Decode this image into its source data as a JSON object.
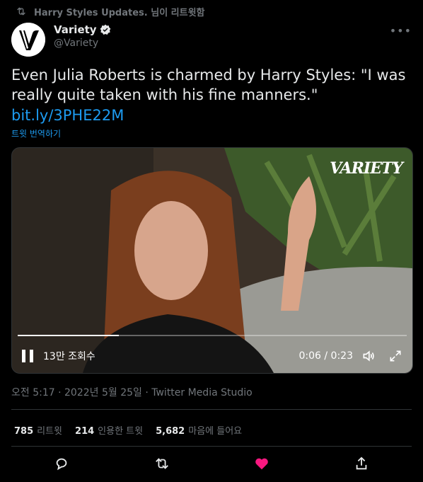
{
  "retweet": {
    "text": "Harry Styles Updates. 님이 리트윗함",
    "icon": "retweet-icon"
  },
  "author": {
    "name": "Variety",
    "handle": "@Variety",
    "verified": true,
    "avatar_icon": "variety-logo-icon"
  },
  "tweet": {
    "text": "Even Julia Roberts is charmed by Harry Styles: \"I was really quite taken with his fine manners.\"",
    "link": "bit.ly/3PHE22M",
    "translate": "트윗 번역하기"
  },
  "video": {
    "logo_text": "VARIETY",
    "views": "13만 조회수",
    "time": "0:06 / 0:23",
    "progress_fraction": 0.26,
    "controls": {
      "pause_icon": "pause-icon",
      "volume_icon": "volume-icon",
      "fullscreen_icon": "expand-icon"
    }
  },
  "meta": {
    "line": "오전 5:17 · 2022년 5월 25일 · Twitter Media Studio"
  },
  "stats": {
    "retweets": {
      "count": "785",
      "label": "리트윗"
    },
    "quotes": {
      "count": "214",
      "label": "인용한 트윗"
    },
    "likes": {
      "count": "5,682",
      "label": "마음에 들어요"
    }
  },
  "actions": [
    "reply-icon",
    "retweet-icon",
    "like-icon",
    "share-icon"
  ],
  "colors": {
    "background": "#000000",
    "accent": "#1d9bf0",
    "muted": "#71767b",
    "like": "#f91880"
  }
}
